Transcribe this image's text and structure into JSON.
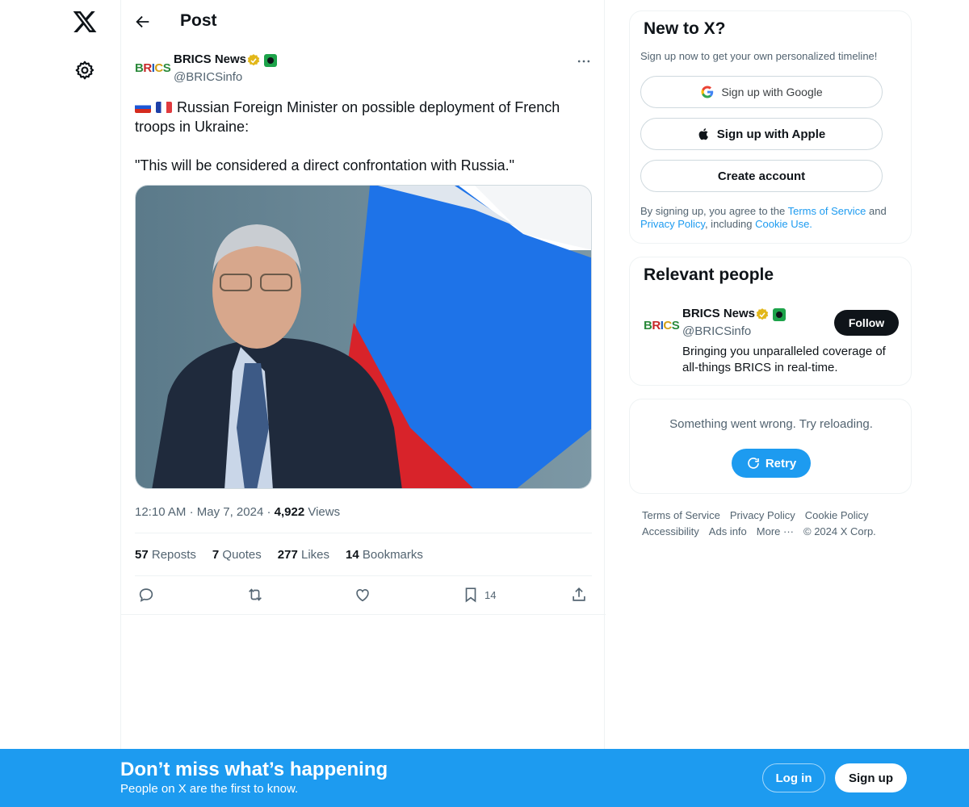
{
  "nav": {
    "logo_icon": "x-logo-icon",
    "settings_icon": "gear-icon"
  },
  "header": {
    "back_icon": "arrow-left-icon",
    "title": "Post"
  },
  "post": {
    "author": {
      "avatar_text": [
        "B",
        "R",
        "I",
        "C",
        "S"
      ],
      "name": "BRICS News",
      "handle": "@BRICSinfo",
      "verified": true
    },
    "text_line1": "Russian Foreign Minister on possible deployment of French troops in Ukraine:",
    "text_line2": "\"This will be considered a direct confrontation with Russia.\"",
    "time": "12:10 AM",
    "date": "May 7, 2024",
    "views_count": "4,922",
    "views_label": "Views",
    "stats": [
      {
        "count": "57",
        "label": "Reposts"
      },
      {
        "count": "7",
        "label": "Quotes"
      },
      {
        "count": "277",
        "label": "Likes"
      },
      {
        "count": "14",
        "label": "Bookmarks"
      }
    ],
    "actions": {
      "reply_icon": "reply-icon",
      "repost_icon": "repost-icon",
      "like_icon": "heart-icon",
      "bookmark_icon": "bookmark-icon",
      "bookmark_count": "14",
      "share_icon": "share-icon"
    }
  },
  "signup_card": {
    "title": "New to X?",
    "subtitle": "Sign up now to get your own personalized timeline!",
    "google_label": "Sign up with Google",
    "apple_label": "Sign up with Apple",
    "create_label": "Create account",
    "legal_prefix": "By signing up, you agree to the ",
    "terms_link": "Terms of Service",
    "legal_and": " and ",
    "privacy_link": "Privacy Policy",
    "legal_including": ", including ",
    "cookie_link": "Cookie Use."
  },
  "relevant": {
    "title": "Relevant people",
    "name": "BRICS News",
    "handle": "@BRICSinfo",
    "follow_label": "Follow",
    "bio": "Bringing you unparalleled coverage of all-things BRICS in real-time."
  },
  "error_card": {
    "message": "Something went wrong. Try reloading.",
    "retry_label": "Retry"
  },
  "footer": {
    "links": [
      "Terms of Service",
      "Privacy Policy",
      "Cookie Policy",
      "Accessibility",
      "Ads info",
      "More ···",
      "© 2024 X Corp."
    ]
  },
  "bottom_bar": {
    "title": "Don’t miss what’s happening",
    "subtitle": "People on X are the first to know.",
    "login_label": "Log in",
    "signup_label": "Sign up"
  },
  "colors": {
    "accent": "#1d9bf0",
    "text": "#0f1419",
    "muted": "#536471",
    "border": "#eff3f4"
  }
}
